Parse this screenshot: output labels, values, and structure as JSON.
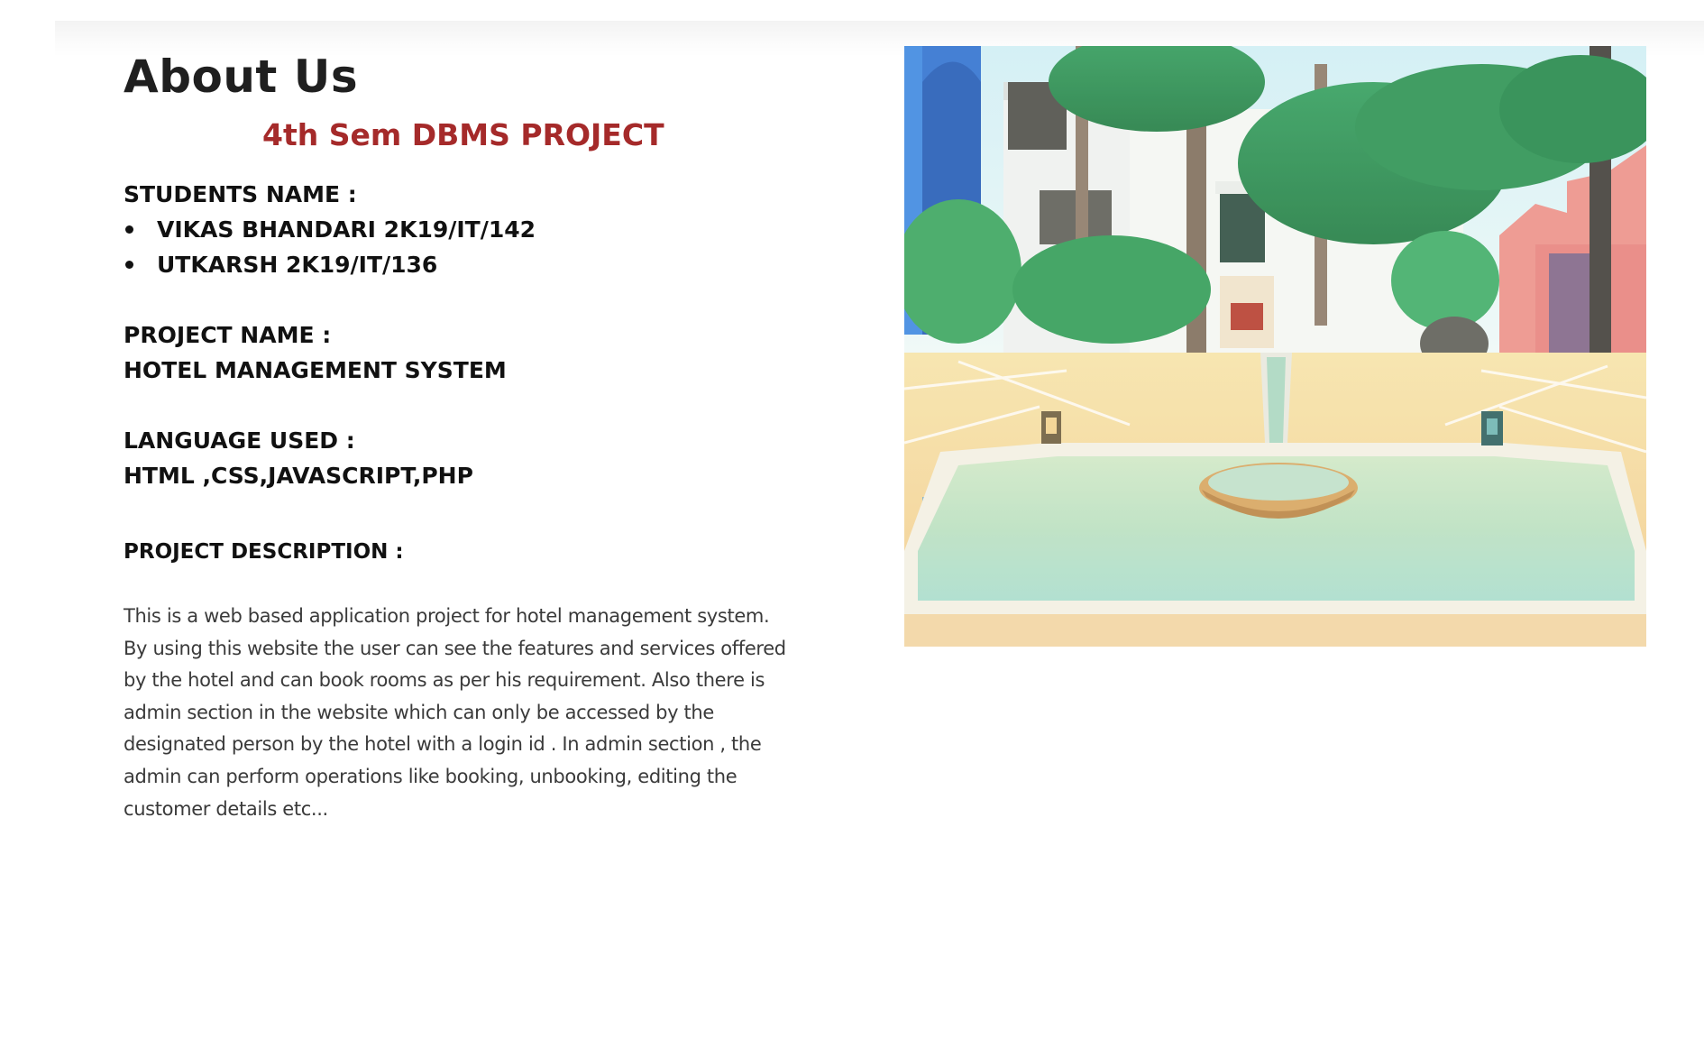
{
  "page": {
    "title": "About Us",
    "subtitle": "4th Sem DBMS PROJECT"
  },
  "students": {
    "label": "STUDENTS NAME :",
    "items": [
      "VIKAS BHANDARI 2K19/IT/142",
      "UTKARSH 2K19/IT/136"
    ]
  },
  "project": {
    "label": "PROJECT NAME :",
    "value": "HOTEL MANAGEMENT SYSTEM"
  },
  "language": {
    "label": "LANGUAGE USED :",
    "value": "HTML ,CSS,JAVASCRIPT,PHP"
  },
  "description": {
    "label": "PROJECT DESCRIPTION :",
    "text": "This is a web based application project for hotel management system. By using this website the user can see the features and services offered by the hotel and can book rooms as per his requirement. Also there is admin section in the website which can only be accessed by the designated person by the hotel with a login id . In admin section , the admin can perform operations like booking, unbooking, editing the customer details etc..."
  },
  "colors": {
    "subtitle": "#a52a2a",
    "heading": "#1f1f1f",
    "body_text": "#3a3a3a"
  },
  "image": {
    "subject": "hotel-courtyard-fountain-photo"
  }
}
